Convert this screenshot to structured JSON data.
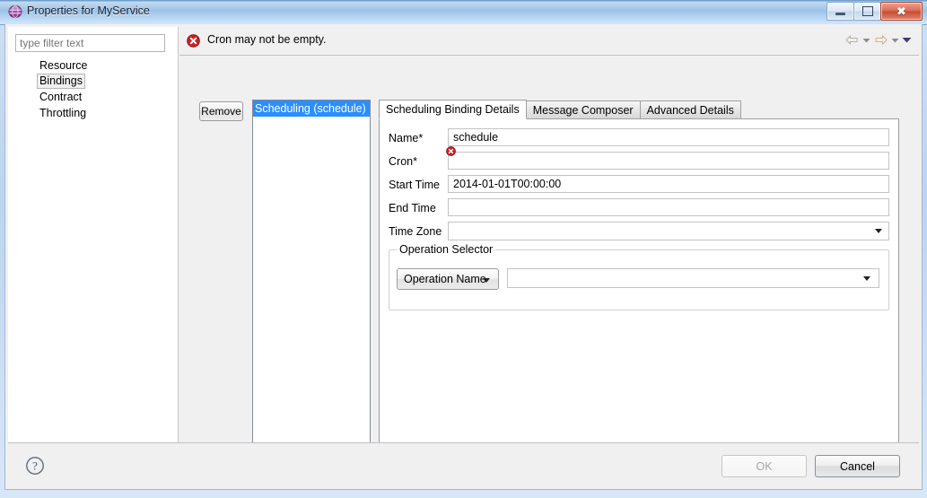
{
  "window": {
    "title": "Properties for MyService",
    "icon": "properties-sphere-icon",
    "minimize_label": "Minimize",
    "maximize_label": "Maximize",
    "close_label": "Close"
  },
  "sidebar": {
    "filter_placeholder": "type filter text",
    "filter_value": "",
    "items": [
      {
        "label": "Resource",
        "selected": false
      },
      {
        "label": "Bindings",
        "selected": true
      },
      {
        "label": "Contract",
        "selected": false
      },
      {
        "label": "Throttling",
        "selected": false
      }
    ]
  },
  "message_bar": {
    "icon": "error-icon",
    "text": "Cron may not be empty.",
    "nav": {
      "back_icon": "arrow-left-icon",
      "back_caret_icon": "chevron-down-icon",
      "forward_icon": "arrow-right-icon",
      "forward_caret_icon": "chevron-down-icon",
      "menu_caret_icon": "chevron-down-filled-icon"
    }
  },
  "bindings_panel": {
    "remove_label": "Remove",
    "list": [
      {
        "label": "Scheduling (schedule)",
        "selected": true
      }
    ]
  },
  "tabs": [
    {
      "label": "Scheduling Binding Details",
      "active": true
    },
    {
      "label": "Message Composer",
      "active": false
    },
    {
      "label": "Advanced Details",
      "active": false
    }
  ],
  "form": {
    "name": {
      "label": "Name*",
      "value": "schedule",
      "placeholder": ""
    },
    "cron": {
      "label": "Cron*",
      "value": "",
      "placeholder": "",
      "error_icon": "error-decorator-icon"
    },
    "start_time": {
      "label": "Start Time",
      "value": "2014-01-01T00:00:00",
      "placeholder": ""
    },
    "end_time": {
      "label": "End Time",
      "value": "",
      "placeholder": ""
    },
    "time_zone": {
      "label": "Time Zone",
      "value": "",
      "dropdown_icon": "chevron-down-icon"
    }
  },
  "operation_selector": {
    "group_label": "Operation Selector",
    "type_button": {
      "label": "Operation Name",
      "dropdown_icon": "chevron-down-icon"
    },
    "value_combo": {
      "value": "",
      "dropdown_icon": "chevron-down-icon"
    }
  },
  "footer": {
    "help_icon": "help-question-icon",
    "ok_label": "OK",
    "ok_enabled": false,
    "cancel_label": "Cancel"
  },
  "colors": {
    "selection_blue": "#2a8fff",
    "error_red": "#cc2027",
    "titlebar_blue": "#9cc2e6",
    "dialog_gray": "#f0f0f0"
  }
}
